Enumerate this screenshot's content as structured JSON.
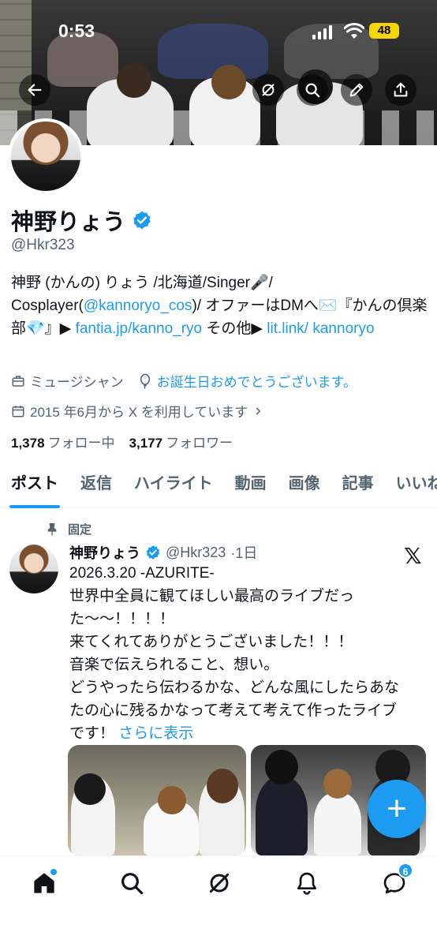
{
  "status_bar": {
    "time": "0:53",
    "battery": "48"
  },
  "profile": {
    "name": "神野りょう",
    "handle": "@Hkr323",
    "bio": {
      "part1": "神野 (かんの) りょう /北海道/Singer🎤/ Cosplayer(",
      "link1": "@kannoryo_cos",
      "part2": ")/ オファーはDMへ✉️『かんの倶楽部💎』▶︎ ",
      "link2": "fantia.jp/kanno_ryo",
      "part3": " その他▶︎ ",
      "link3": "lit.link/ kannoryo"
    },
    "category": "ミュージシャン",
    "birthday": "お誕生日おめでとうございます。",
    "joined": "2015 年6月から X を利用しています",
    "following_count": "1,378",
    "following_label": "フォロー中",
    "followers_count": "3,177",
    "followers_label": "フォロワー"
  },
  "tabs": [
    {
      "label": "ポスト",
      "active": true
    },
    {
      "label": "返信"
    },
    {
      "label": "ハイライト"
    },
    {
      "label": "動画"
    },
    {
      "label": "画像"
    },
    {
      "label": "記事"
    },
    {
      "label": "いいね"
    }
  ],
  "post": {
    "pinned_label": "固定",
    "author_name": "神野りょう",
    "author_handle": "@Hkr323",
    "time": "·1日",
    "text": "2026.3.20 -AZURITE-\n世界中全員に観てほしい最高のライブだっ\nた〜〜！！！！\n来てくれてありがとうございました！！！\n音楽で伝えられること、想い。\nどうやったら伝わるかな、どんな風にしたらあな\nたの心に残るかなって考えて考えて作ったライブ\nです！ ",
    "more": "さらに表示"
  },
  "fab": {
    "label": "+"
  },
  "nav": {
    "messages_badge": "6"
  },
  "colors": {
    "accent": "#1d9bf0",
    "text": "#0f1419",
    "secondary": "#536471"
  }
}
